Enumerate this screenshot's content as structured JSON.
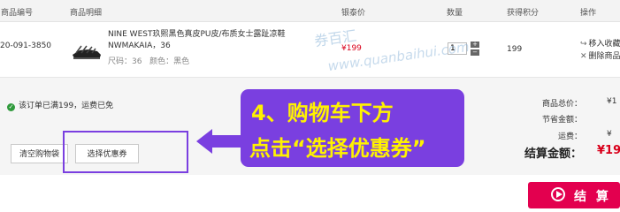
{
  "header": {
    "col_sku": "商品编号",
    "col_detail": "商品明细",
    "col_price": "银泰价",
    "col_qty": "数量",
    "col_points": "获得积分",
    "col_action": "操作"
  },
  "item": {
    "sku": "20-091-3850",
    "name": "NINE WEST玖熙黑色真皮PU皮/布质女士露趾凉鞋 NWMAKAIA，36",
    "size_label": "尺码：",
    "size": "36",
    "color_label": "颜色：",
    "color": "黑色",
    "price": "¥199",
    "qty": "1",
    "qty_plus": "+",
    "qty_minus": "−",
    "points": "199",
    "action_fav": "移入收藏",
    "action_del": "删除商品"
  },
  "watermark": {
    "line1": "券百汇",
    "line2": "www.quanbaihui.com"
  },
  "summary": {
    "free_shipping": "该订单已满199，运费已免",
    "clear_cart": "清空购物袋",
    "choose_coupon": "选择优惠券",
    "total_label": "商品总价：",
    "total_value": "¥1",
    "saving_label": "节省金额：",
    "saving_value": "",
    "shipping_label": "运费：",
    "shipping_value": "¥",
    "pay_label": "结算金额：",
    "pay_value": "¥19"
  },
  "callout": {
    "line1": "4、购物车下方",
    "line2": "点击“选择优惠券”"
  },
  "checkout": {
    "label": "结 算"
  },
  "colors": {
    "accent_purple": "#7a3fe0",
    "callout_text": "#fff200",
    "price_red": "#d9001b",
    "checkout_pink": "#e3004f"
  }
}
